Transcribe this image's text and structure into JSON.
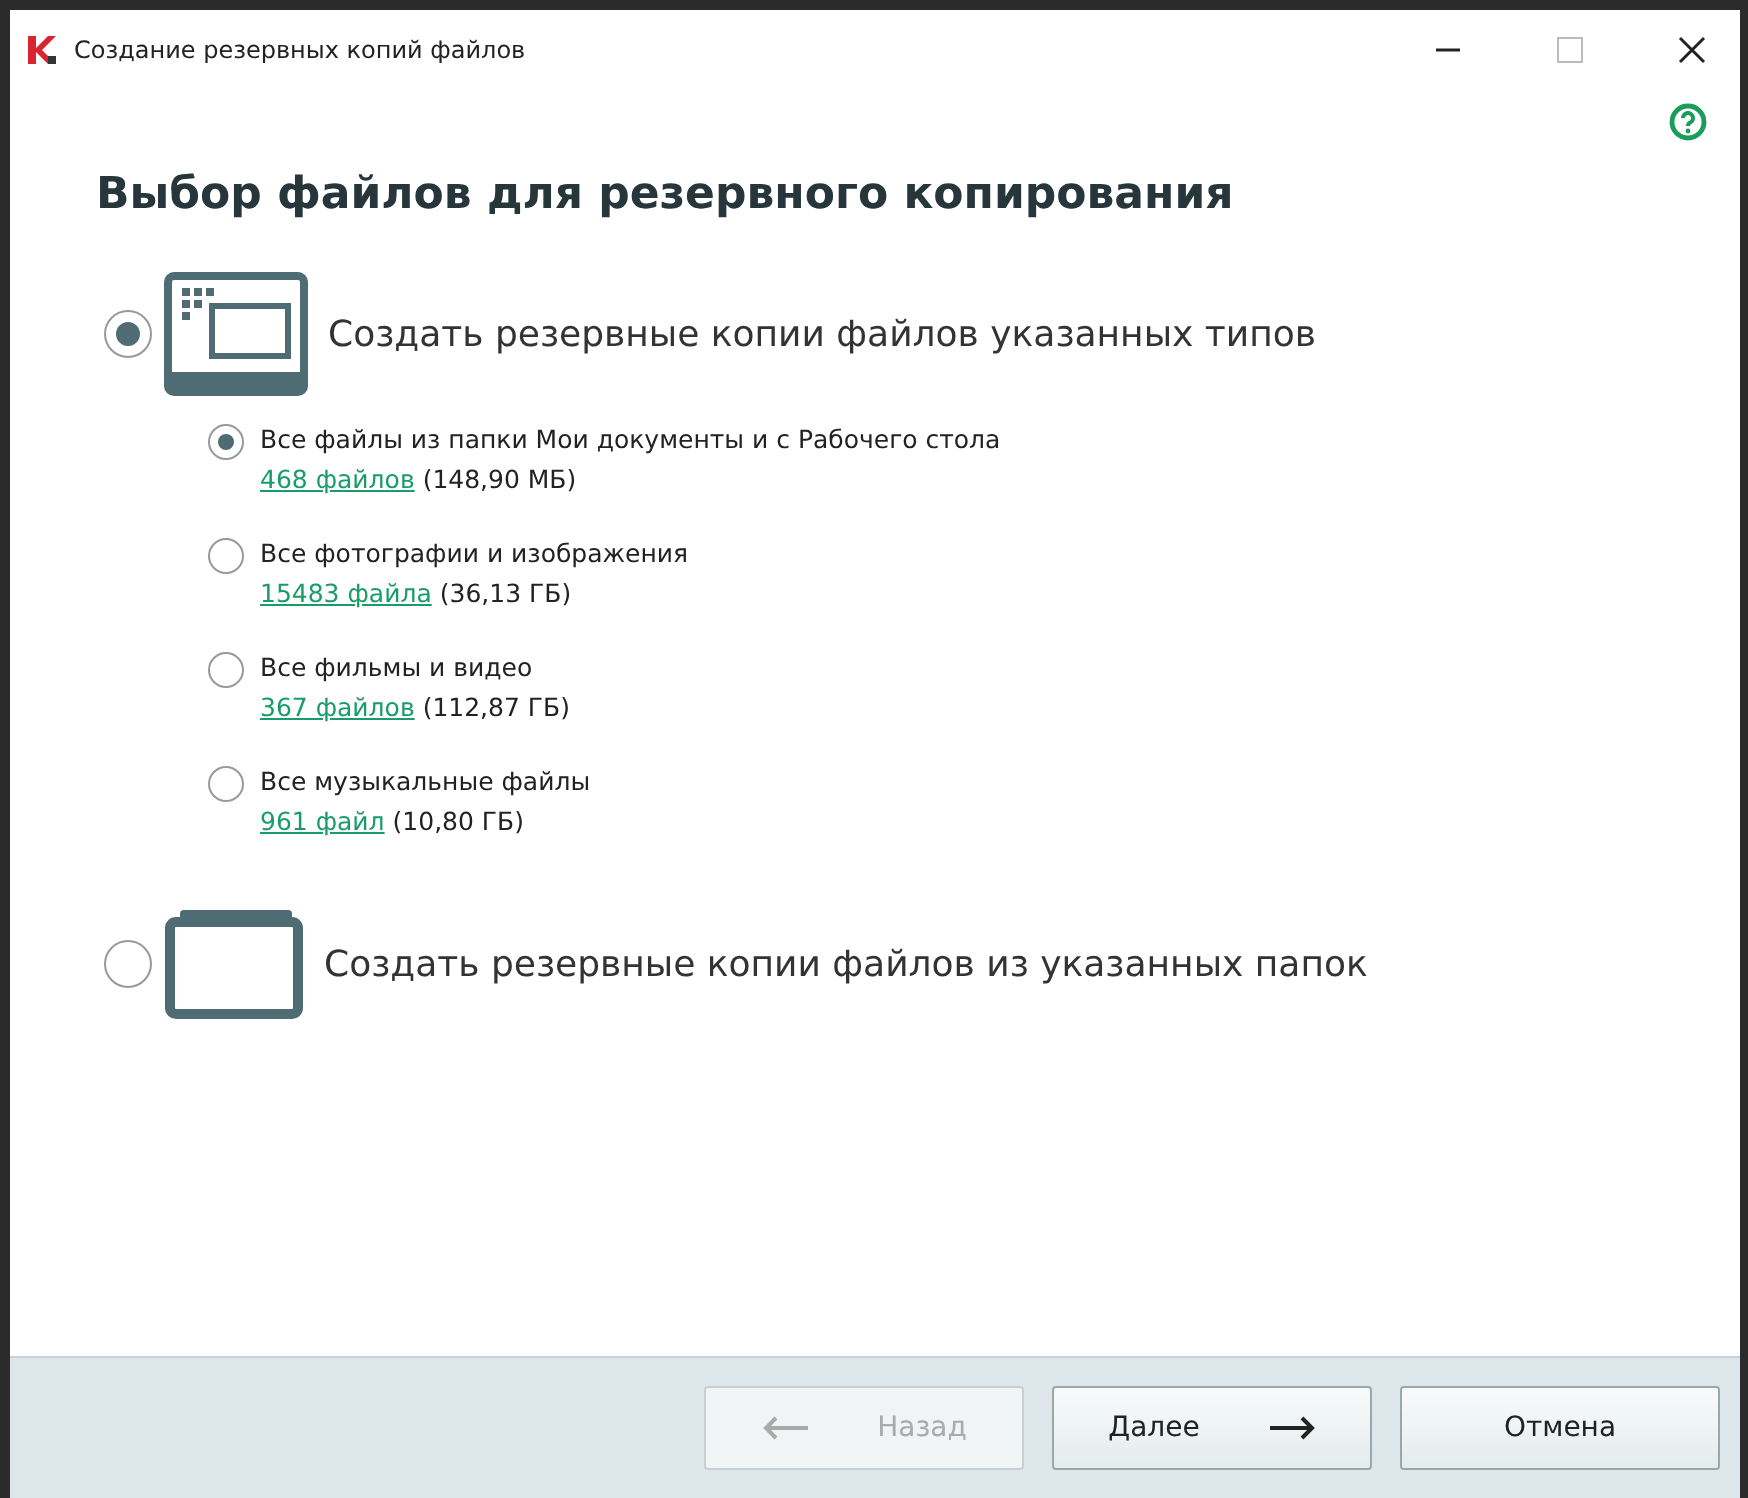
{
  "window": {
    "title": "Создание резервных копий файлов"
  },
  "heading": "Выбор файлов для резервного копирования",
  "options": [
    {
      "kind": "types",
      "label": "Создать резервные копии файлов указанных типов",
      "selected": true,
      "children": [
        {
          "label": "Все файлы из папки Мои документы и с Рабочего стола",
          "link": "468 файлов",
          "size": "(148,90 МБ)",
          "selected": true
        },
        {
          "label": "Все фотографии и изображения",
          "link": "15483 файла",
          "size": "(36,13 ГБ)",
          "selected": false
        },
        {
          "label": "Все фильмы и видео",
          "link": "367 файлов",
          "size": "(112,87 ГБ)",
          "selected": false
        },
        {
          "label": "Все музыкальные файлы",
          "link": "961 файл",
          "size": "(10,80 ГБ)",
          "selected": false
        }
      ]
    },
    {
      "kind": "folders",
      "label": "Создать резервные копии файлов из указанных папок",
      "selected": false
    }
  ],
  "buttons": [
    {
      "kind": "back",
      "label": "Назад",
      "disabled": true
    },
    {
      "kind": "next",
      "label": "Далее",
      "disabled": false
    },
    {
      "kind": "cancel",
      "label": "Отмена",
      "disabled": false
    }
  ]
}
